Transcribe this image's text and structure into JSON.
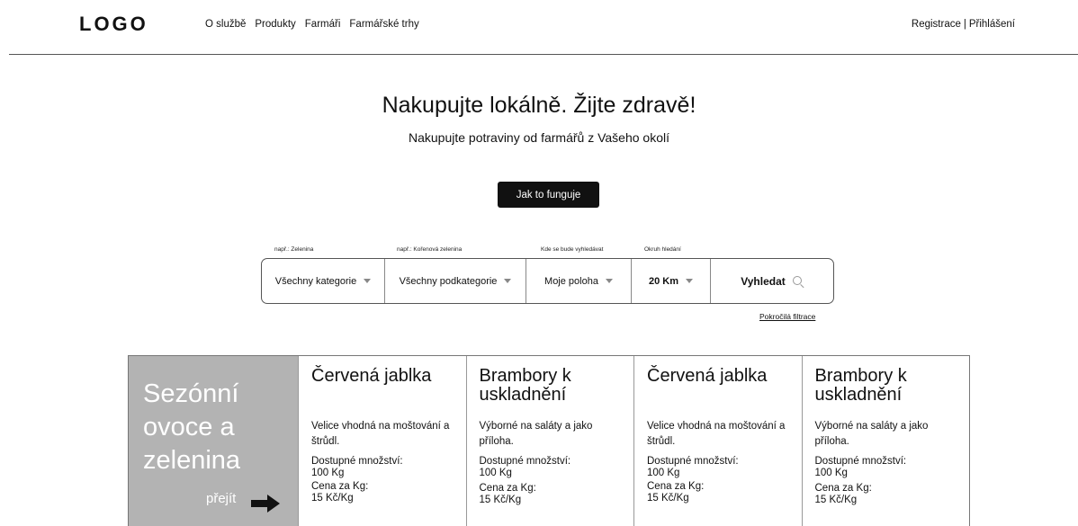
{
  "header": {
    "logo": "LOGO",
    "nav": [
      "O službě",
      "Produkty",
      "Farmáři",
      "Farmářské trhy"
    ],
    "register": "Registrace",
    "separator": "|",
    "login": "Přihlášení"
  },
  "hero": {
    "title": "Nakupujte lokálně. Žijte zdravě!",
    "subtitle": "Nakupujte potraviny od farmářů z Vašeho okolí",
    "how_button": "Jak to funguje"
  },
  "search": {
    "hints": [
      "např.: Zelenina",
      "např.: Kořenová zelenina",
      "Kde se bude vyhledávat",
      "Okruh hledání"
    ],
    "category": "Všechny kategorie",
    "subcategory": "Všechny podkategorie",
    "location": "Moje poloha",
    "radius": "20 Km",
    "search_button": "Vyhledat",
    "advanced": "Pokročilá filtrace"
  },
  "promo": {
    "title": "Sezónní ovoce a zelenina",
    "go": "přejít"
  },
  "products": [
    {
      "title": "Červená jablka",
      "desc": "Velice vhodná na moštování a štrůdl.",
      "qty_label": "Dostupné množství:",
      "qty": "100 Kg",
      "price_label": "Cena za Kg:",
      "price": "15 Kč/Kg"
    },
    {
      "title": "Brambory k uskladnění",
      "desc": "Výborné na saláty a jako příloha.",
      "qty_label": "Dostupné množství:",
      "qty": "100 Kg",
      "price_label": "Cena za Kg:",
      "price": "15 Kč/Kg"
    },
    {
      "title": "Červená jablka",
      "desc": "Velice vhodná na moštování a štrůdl.",
      "qty_label": "Dostupné množství:",
      "qty": "100 Kg",
      "price_label": "Cena za Kg:",
      "price": "15 Kč/Kg"
    },
    {
      "title": "Brambory k uskladnění",
      "desc": "Výborné na saláty a jako příloha.",
      "qty_label": "Dostupné množství:",
      "qty": "100 Kg",
      "price_label": "Cena za Kg:",
      "price": "15 Kč/Kg"
    }
  ]
}
